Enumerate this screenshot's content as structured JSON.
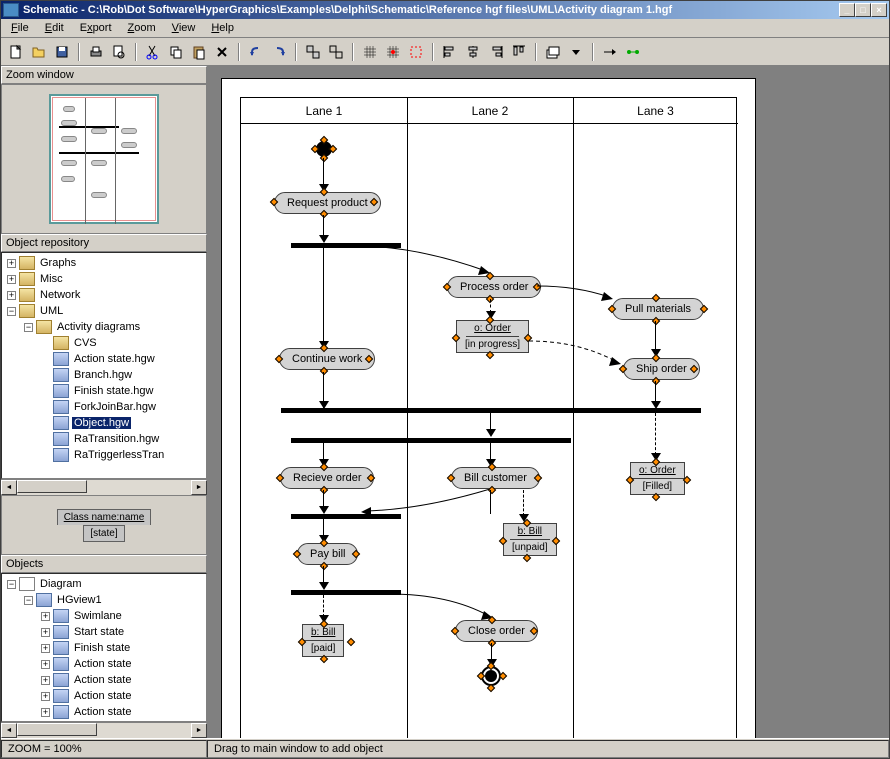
{
  "title": "Schematic - C:\\Rob\\Dot Software\\HyperGraphics\\Examples\\Delphi\\Schematic\\Reference hgf files\\UML\\Activity diagram 1.hgf",
  "menu": {
    "file": "File",
    "edit": "Edit",
    "export": "Export",
    "zoom": "Zoom",
    "view": "View",
    "help": "Help"
  },
  "panels": {
    "zoom_window": "Zoom window",
    "object_repository": "Object repository",
    "objects": "Objects"
  },
  "repo_tree": {
    "graphs": "Graphs",
    "misc": "Misc",
    "network": "Network",
    "uml": "UML",
    "activity_diagrams": "Activity diagrams",
    "cvs": "CVS",
    "files": {
      "action_state": "Action state.hgw",
      "branch": "Branch.hgw",
      "finish_state": "Finish state.hgw",
      "fork_join": "ForkJoinBar.hgw",
      "object": "Object.hgw",
      "ra_transition": "RaTransition.hgw",
      "ra_triggerless": "RaTriggerlessTran"
    }
  },
  "preview": {
    "class_name": "Class name:name",
    "state": "[state]"
  },
  "objects_tree": {
    "diagram": "Diagram",
    "hgview": "HGview1",
    "swimlane": "Swimlane",
    "start_state": "Start state",
    "finish_state": "Finish state",
    "action_state": "Action state"
  },
  "canvas": {
    "lanes": [
      "Lane 1",
      "Lane 2",
      "Lane 3"
    ],
    "activities": {
      "request_product": "Request product",
      "process_order": "Process order",
      "pull_materials": "Pull materials",
      "continue_work": "Continue work",
      "ship_order": "Ship order",
      "recieve_order": "Recieve order",
      "bill_customer": "Bill customer",
      "pay_bill": "Pay bill",
      "close_order": "Close order"
    },
    "objects": {
      "order_in_progress": {
        "name": "o: Order",
        "state": "[in progress]"
      },
      "order_filled": {
        "name": "o: Order",
        "state": "[Filled]"
      },
      "bill_unpaid": {
        "name": "b: Bill",
        "state": "[unpaid]"
      },
      "bill_paid": {
        "name": "b: Bill",
        "state": "[paid]"
      }
    }
  },
  "status": {
    "zoom": "ZOOM = 100%",
    "hint": "Drag to main window to add object"
  }
}
